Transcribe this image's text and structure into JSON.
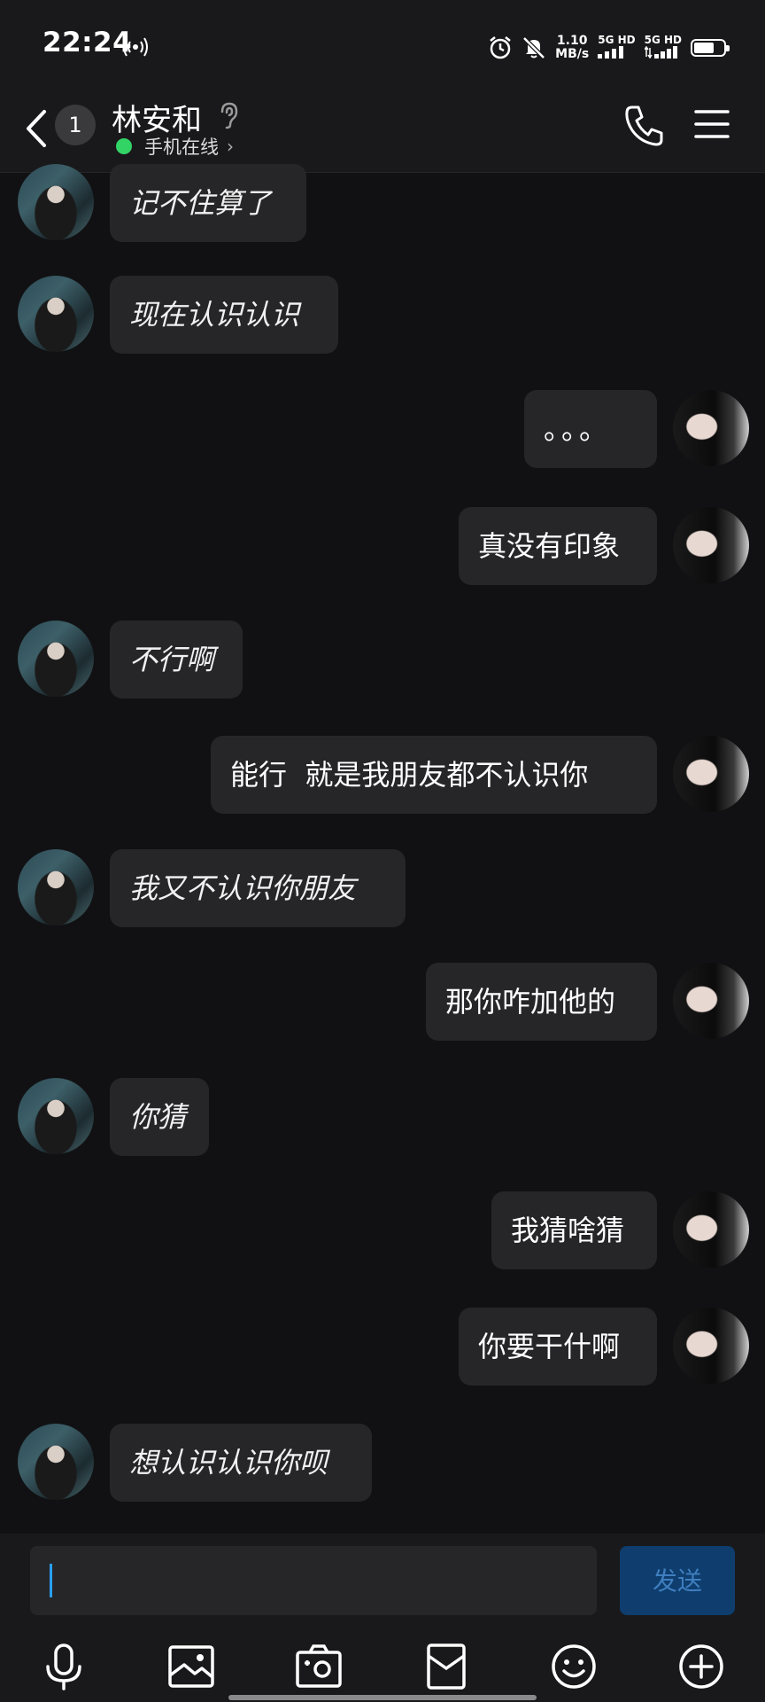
{
  "status_bar": {
    "time": "22:24",
    "speed_value": "1.10",
    "speed_unit": "MB/s",
    "network_1": "5G HD",
    "network_2": "5G HD",
    "icons": [
      "hotspot-icon",
      "alarm-icon",
      "mute-icon",
      "signal-icon",
      "battery-icon"
    ]
  },
  "header": {
    "unread_count": "1",
    "contact_name": "林安和",
    "online_status": "手机在线",
    "online_color": "#33d466",
    "icons": [
      "back-icon",
      "ear-icon",
      "phone-icon",
      "menu-icon"
    ]
  },
  "messages": [
    {
      "sender": "friend",
      "text": "记不住算了"
    },
    {
      "sender": "friend",
      "text": "现在认识认识"
    },
    {
      "sender": "me",
      "text": "。。。"
    },
    {
      "sender": "me",
      "text": "真没有印象"
    },
    {
      "sender": "friend",
      "text": "不行啊"
    },
    {
      "sender": "me",
      "text": "能行  就是我朋友都不认识你"
    },
    {
      "sender": "friend",
      "text": "我又不认识你朋友"
    },
    {
      "sender": "me",
      "text": "那你咋加他的"
    },
    {
      "sender": "friend",
      "text": "你猜"
    },
    {
      "sender": "me",
      "text": "我猜啥猜"
    },
    {
      "sender": "me",
      "text": "你要干什啊"
    },
    {
      "sender": "friend",
      "text": "想认识认识你呗"
    }
  ],
  "composer": {
    "input_value": "",
    "send_label": "发送",
    "send_color": "#0e3d6e",
    "tools": [
      "microphone-icon",
      "image-icon",
      "camera-icon",
      "red-packet-icon",
      "emoji-icon",
      "plus-icon"
    ]
  }
}
